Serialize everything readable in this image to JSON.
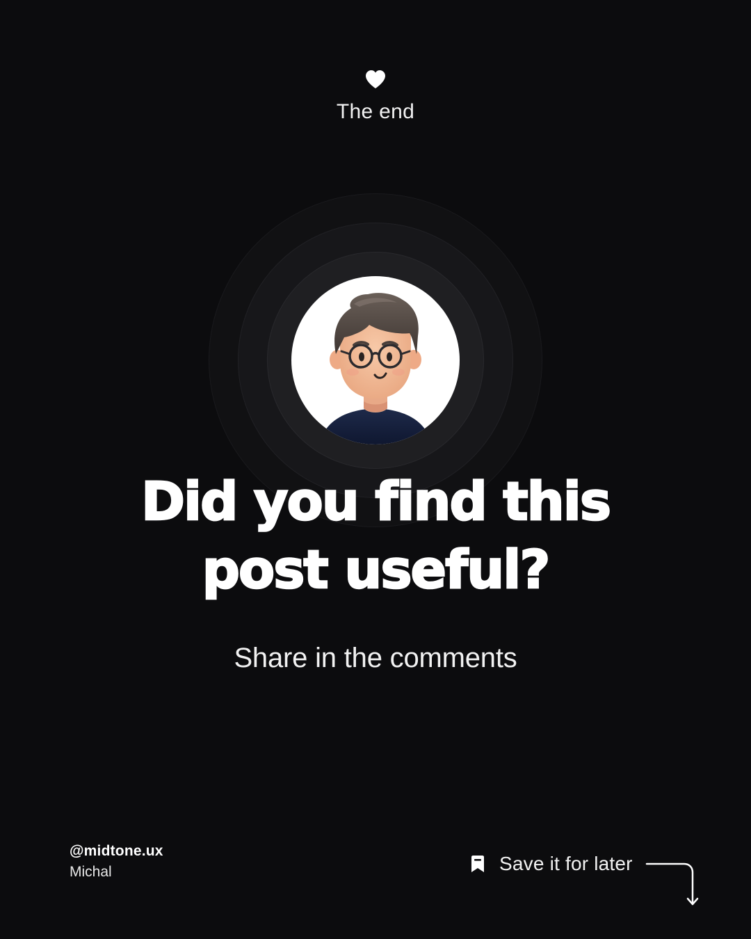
{
  "header": {
    "icon": "heart-icon",
    "label": "The end"
  },
  "avatar": {
    "icon": "avatar-illustration"
  },
  "main": {
    "headline_line1": "Did you find this",
    "headline_line2": "post useful?",
    "subline": "Share in the comments"
  },
  "footer": {
    "handle": "@midtone.ux",
    "name": "Michal",
    "save_icon": "bookmark-icon",
    "save_label": "Save it for later",
    "arrow_icon": "arrow-down-turn-icon"
  },
  "colors": {
    "background": "#0c0c0e",
    "text": "#ffffff",
    "ring_outer": "#111113",
    "ring_mid": "#17171a",
    "ring_inner": "#1f1f22"
  }
}
